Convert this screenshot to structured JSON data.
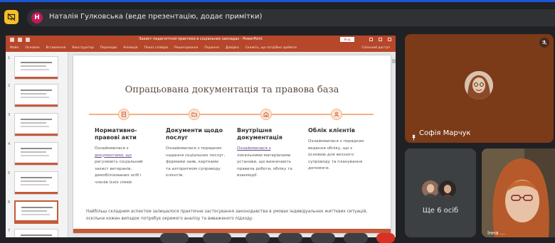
{
  "topbar": {
    "app_icon": "presentation-off-icon",
    "presenter_initial": "Н",
    "presenter_text": "Наталія Гулковська (веде презентацію, додає примітки)"
  },
  "powerpoint": {
    "doc_title": "Захист педагогічної практики в соціальних закладах - PowerPoint",
    "signin_label": "Вхід",
    "menu_tabs": [
      "Файл",
      "Основне",
      "Вставлення",
      "Конструктор",
      "Переходи",
      "Анімація",
      "Показ слайдів",
      "Рецензування",
      "Подання",
      "Довідка",
      "Скажіть, що потрібно зробити"
    ],
    "share_label": "Спільний доступ",
    "thumbnail_numbers": [
      "1",
      "2",
      "3",
      "4",
      "5",
      "6",
      "7"
    ],
    "selected_thumbnail": "6"
  },
  "slide": {
    "title": "Опрацьована документація та правова база",
    "columns": [
      {
        "icon": "document-icon",
        "heading": "Нормативно-правові акти",
        "text_lines": [
          "Ознайомилася з",
          "документами, що",
          "регулюють соціальний",
          "захист ветеранів,",
          "демобілізованих осіб і",
          "членів їхніх сімей."
        ]
      },
      {
        "icon": "folder-icon",
        "heading": "Документи щодо послуг",
        "text_lines": [
          "Ознайомилася з порядком",
          "надання соціальних послуг,",
          "формами заяв, картками",
          "та алгоритмом супроводу",
          "клієнтів."
        ]
      },
      {
        "icon": "building-icon",
        "heading": "Внутрішня документація",
        "text_lines": [
          "Ознайомилася з",
          "локальними матеріалами",
          "установи, що визначають",
          "правила роботи, обліку та",
          "взаємодії."
        ]
      },
      {
        "icon": "person-icon",
        "heading": "Облік клієнтів",
        "text_lines": [
          "Ознайомилася з порядком",
          "ведення обліку, що є",
          "основою для якісного",
          "супроводу та планування",
          "допомоги."
        ]
      }
    ],
    "footer": "Найбільш складним аспектом залишалося практичне застосування законодавства в умовах індивідуальних життєвих ситуацій, оскільки кожен випадок потребує окремого аналізу та виваженого підходу."
  },
  "participants": {
    "main_tile": {
      "name": "Софія Марчук",
      "pin_icon": "pin-icon",
      "mic_icon": "mic-off-icon"
    },
    "more_tile": {
      "label": "Ще 6 осіб"
    },
    "camera_tile": {
      "tag": "Інна ..."
    }
  },
  "colors": {
    "ppt_accent": "#b7472a",
    "slide_accent": "#c55a3a",
    "timeline": "#f4b183",
    "main_tile_bg": "#7b3a18",
    "meet_bg": "#202124"
  }
}
